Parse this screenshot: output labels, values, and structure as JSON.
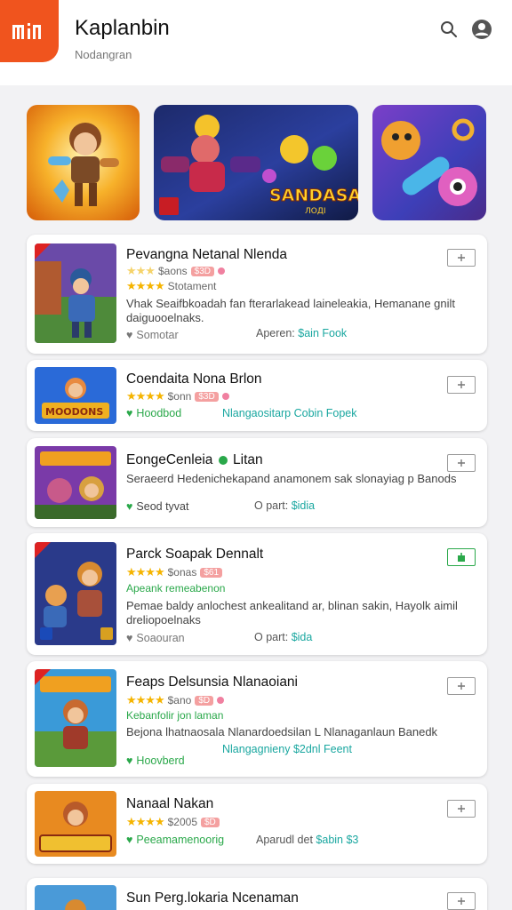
{
  "header": {
    "title": "Kaplanbin",
    "subtitle": "Nodangran",
    "logo_text": "mlı",
    "search_icon": "search-icon",
    "profile_icon": "user-circle-icon"
  },
  "banners": [
    {
      "name": "hero-character-banner"
    },
    {
      "name": "featured-game-banner",
      "label": "SANDASAN",
      "sub": "ЛОДІ"
    },
    {
      "name": "cartoon-pets-banner"
    }
  ],
  "apps": [
    {
      "title": "Pevangna Netanal Nlenda",
      "price": "$aons",
      "badge": "$3D",
      "sub_rating": "Stotament",
      "description": "Vhak Seaifbkoadah fan fterarlakead laineleakia, Hemanane gnilt daiguooelnaks.",
      "foot_left": "Somotar",
      "foot_right_label": "Aperen:",
      "foot_right_value": "$ain Fook"
    },
    {
      "title": "Coendaita Nona Brlon",
      "price": "$onn",
      "badge": "$3D",
      "foot_left": "Hoodbod",
      "foot_right_label": "Nlangaositarp",
      "foot_right_value": "Cobin Fopek"
    },
    {
      "title": "EongeCenleia",
      "title_suffix": "Litan",
      "description": "Seraeerd Hedenichekapand anamonem sak slonayiag p Banods",
      "foot_left": "Seod tyvat",
      "foot_right_label": "O part:",
      "foot_right_value": "$idia"
    },
    {
      "title": "Parck Soapak Dennalt",
      "price": "$onas",
      "badge": "$61",
      "green_line": "Apeank remeabenon",
      "description": "Pemae baldy anlochest ankealitand ar, blinan sakin, Hayolk aimil dreliopoelnaks",
      "foot_left": "Soaouran",
      "foot_right_label": "O part:",
      "foot_right_value": "$ida"
    },
    {
      "title": "Feaps Delsunsia Nlanaoiani",
      "price": "$ano",
      "badge": "$D",
      "green_line": "Kebanfolir jon laman",
      "description": "Bejona lhatnaosala Nlanardoedsilan L Nlanaganlaun Banedk",
      "foot_left": "Hoovberd",
      "foot_right_label": "Nlangagnieny",
      "foot_right_value": "$2dnl Feent"
    },
    {
      "title": "Nanaal Nakan",
      "price": "$2005",
      "badge": "$D",
      "foot_left": "Peeamamenoorig",
      "foot_right_label": "Aparudl det",
      "foot_right_value": "$abin $3"
    },
    {
      "title": "Sun Perg.lokaria Ncenaman"
    }
  ]
}
